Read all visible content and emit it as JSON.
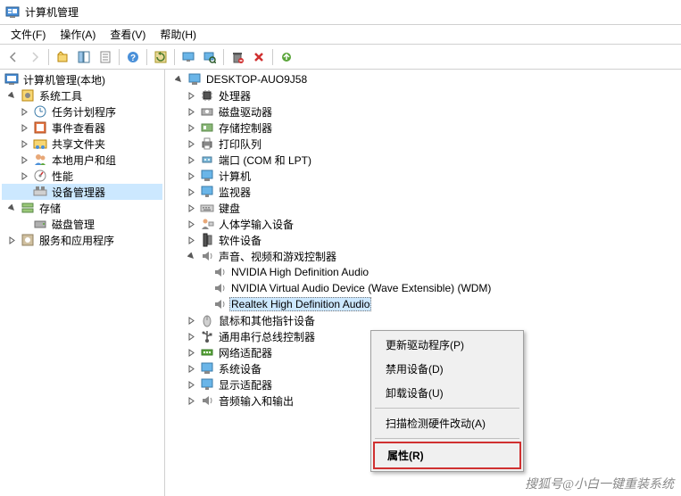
{
  "title": "计算机管理",
  "menu": {
    "file": "文件(F)",
    "action": "操作(A)",
    "view": "查看(V)",
    "help": "帮助(H)"
  },
  "left_tree": {
    "root": "计算机管理(本地)",
    "system_tools": "系统工具",
    "task_scheduler": "任务计划程序",
    "event_viewer": "事件查看器",
    "shared_folders": "共享文件夹",
    "local_users": "本地用户和组",
    "performance": "性能",
    "device_manager": "设备管理器",
    "storage": "存储",
    "disk_management": "磁盘管理",
    "services_apps": "服务和应用程序"
  },
  "devices": {
    "computer": "DESKTOP-AUO9J58",
    "processor": "处理器",
    "disk_drives": "磁盘驱动器",
    "storage_controllers": "存储控制器",
    "print_queues": "打印队列",
    "ports": "端口 (COM 和 LPT)",
    "computer_cat": "计算机",
    "monitors": "监视器",
    "keyboards": "键盘",
    "hid": "人体学输入设备",
    "software_devices": "软件设备",
    "sound": "声音、视频和游戏控制器",
    "sound_items": {
      "nvidia_hd": "NVIDIA High Definition Audio",
      "nvidia_virtual": "NVIDIA Virtual Audio Device (Wave Extensible) (WDM)",
      "realtek": "Realtek High Definition Audio"
    },
    "mice": "鼠标和其他指针设备",
    "usb": "通用串行总线控制器",
    "network": "网络适配器",
    "system_devices": "系统设备",
    "display": "显示适配器",
    "audio_io": "音频输入和输出"
  },
  "context_menu": {
    "update_driver": "更新驱动程序(P)",
    "disable_device": "禁用设备(D)",
    "uninstall_device": "卸载设备(U)",
    "scan_hardware": "扫描检测硬件改动(A)",
    "properties": "属性(R)"
  },
  "watermark": "搜狐号@小白一键重装系统"
}
